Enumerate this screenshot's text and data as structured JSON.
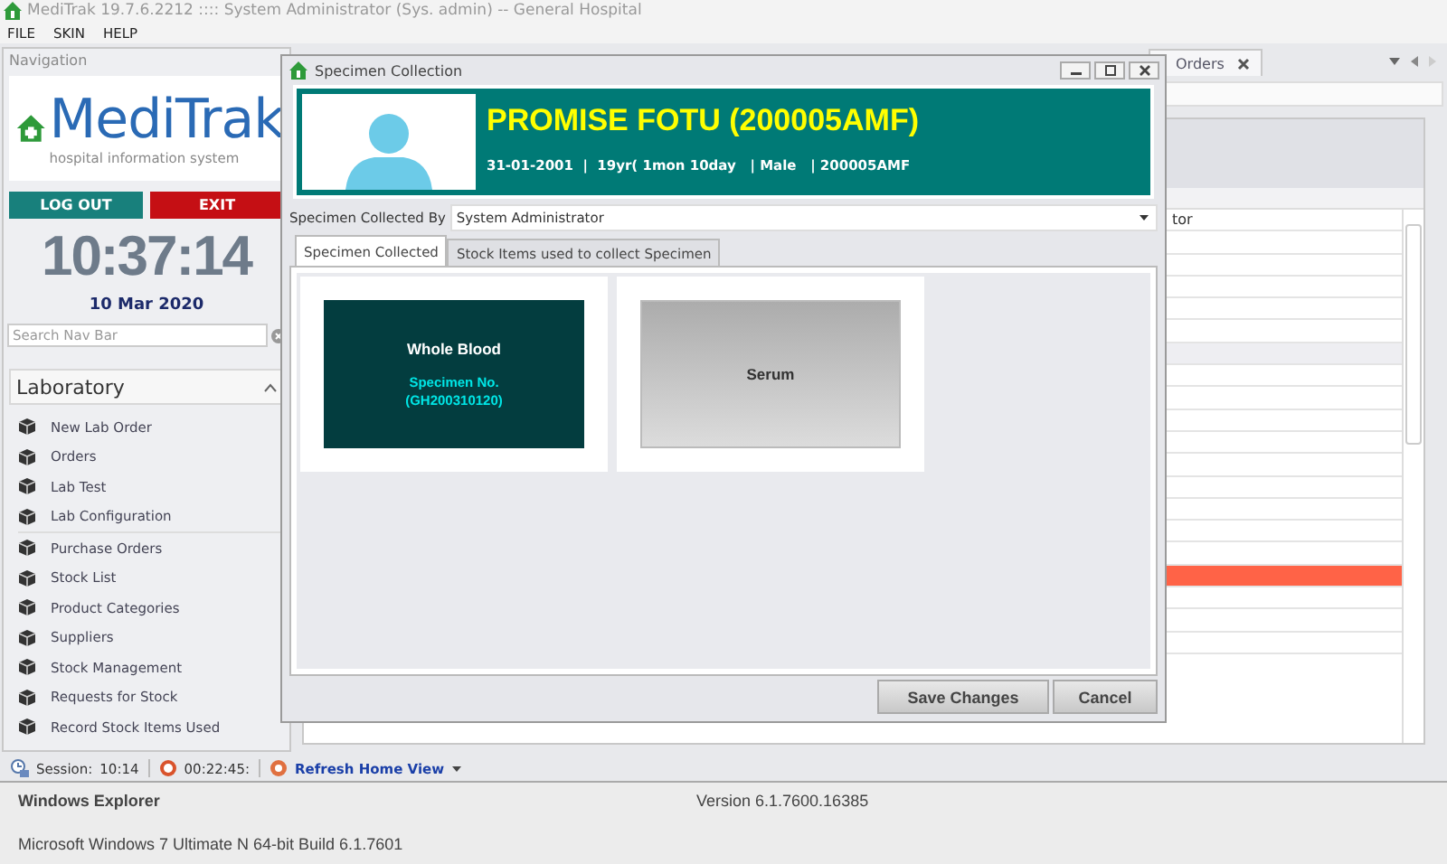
{
  "window": {
    "title": "MediTrak 19.7.6.2212 :::: System Administrator (Sys. admin) -- General Hospital"
  },
  "menu": [
    "FILE",
    "SKIN",
    "HELP"
  ],
  "navigation": {
    "title": "Navigation",
    "logo_name": "MediTrak",
    "logo_tagline": "hospital information system",
    "logout": "LOG OUT",
    "exit": "EXIT",
    "clock": "10:37:14",
    "date": "10 Mar 2020",
    "search_placeholder": "Search Nav Bar",
    "group": "Laboratory",
    "expanded": true,
    "sections": [
      {
        "items": [
          "New Lab Order",
          "Orders",
          "Lab Test",
          "Lab Configuration"
        ]
      },
      {
        "items": [
          "Purchase Orders",
          "Stock List",
          "Product Categories",
          "Suppliers",
          "Stock Management",
          "Requests for Stock",
          "Record Stock Items Used"
        ]
      }
    ]
  },
  "document_tab": {
    "label": "Orders",
    "selected": true
  },
  "grid": {
    "rows": [
      {
        "cell": "tor",
        "highlighted": false,
        "focused": false
      },
      {
        "highlighted": false,
        "focused": false
      },
      {
        "highlighted": false,
        "focused": false
      },
      {
        "highlighted": false,
        "focused": false
      },
      {
        "highlighted": false,
        "focused": false
      },
      {
        "highlighted": false,
        "focused": false
      },
      {
        "highlighted": false,
        "focused": true
      },
      {
        "highlighted": false,
        "focused": false
      },
      {
        "highlighted": false,
        "focused": false
      },
      {
        "highlighted": false,
        "focused": false
      },
      {
        "highlighted": false,
        "focused": false
      },
      {
        "highlighted": false,
        "focused": false
      },
      {
        "highlighted": false,
        "focused": false
      },
      {
        "highlighted": false,
        "focused": false
      },
      {
        "highlighted": false,
        "focused": false
      },
      {
        "highlighted": false,
        "focused": false
      },
      {
        "highlighted": true,
        "focused": false
      },
      {
        "highlighted": false,
        "focused": false
      },
      {
        "highlighted": false,
        "focused": false
      },
      {
        "highlighted": false,
        "focused": false
      }
    ]
  },
  "dialog": {
    "title": "Specimen Collection",
    "patient_name": "PROMISE FOTU (200005AMF)",
    "patient_details": "31-01-2001  |  19yr( 1mon 10day   | Male   | 200005AMF",
    "collected_by_label": "Specimen Collected By",
    "collected_by": "System Administrator",
    "tabs": [
      {
        "label": "Specimen Collected",
        "selected": true
      },
      {
        "label": "Stock Items used to collect Specimen",
        "selected": false
      }
    ],
    "specimens": [
      {
        "name": "Whole Blood",
        "collected": true,
        "number_label": "Specimen No.",
        "number": "(GH200310120)"
      },
      {
        "name": "Serum",
        "collected": false
      }
    ],
    "buttons": [
      "Save Changes",
      "Cancel"
    ]
  },
  "status_bar": {
    "session_label": "Session:",
    "session_time": "10:14",
    "timer": "00:22:45:",
    "refresh": "Refresh Home View"
  },
  "about": {
    "product": "Windows Explorer",
    "version": "Version 6.1.7600.16385",
    "os": "Microsoft Windows 7 Ultimate N  64-bit Build 6.1.7601"
  }
}
